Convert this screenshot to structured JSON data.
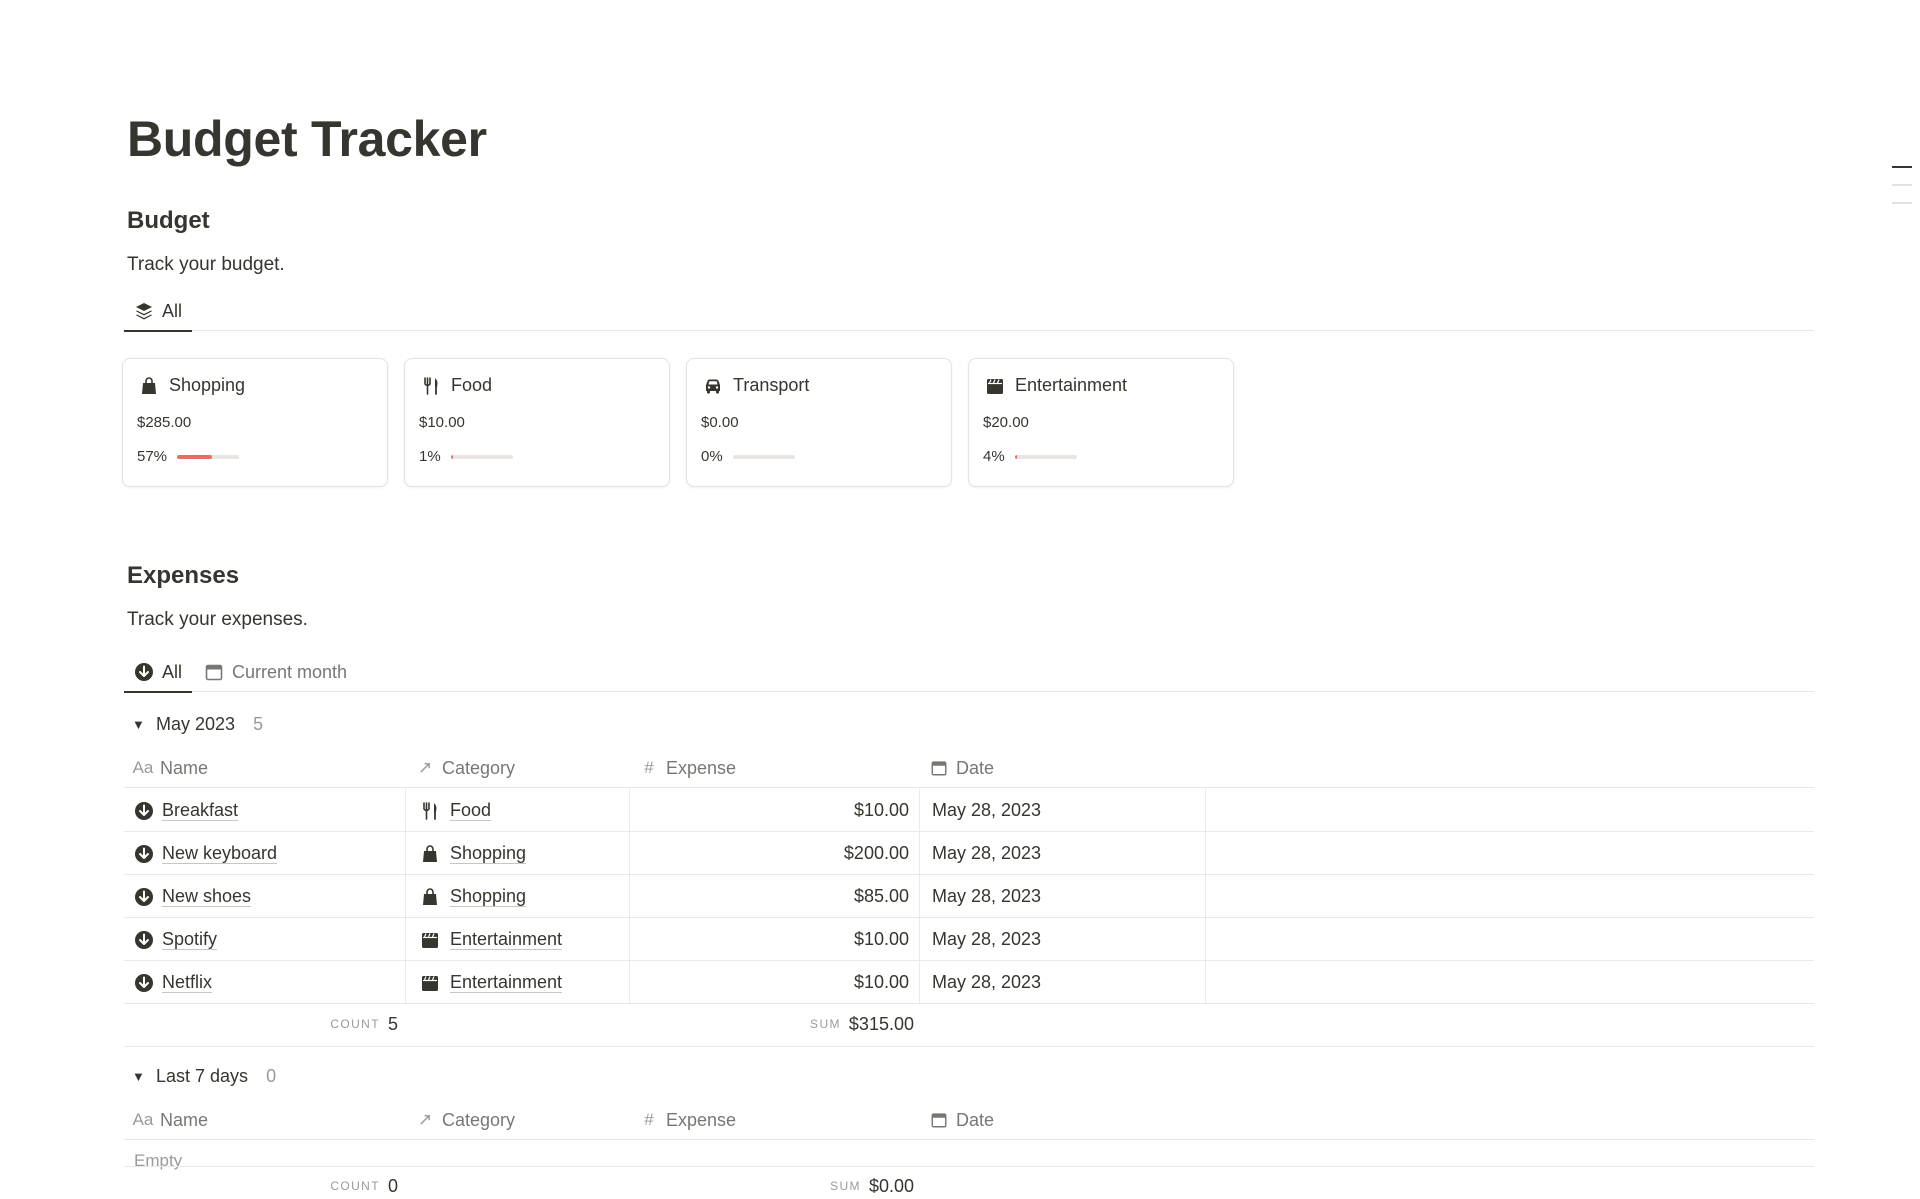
{
  "page": {
    "title": "Budget Tracker"
  },
  "toc": {
    "items": [
      "",
      "",
      ""
    ]
  },
  "budget": {
    "title": "Budget",
    "description": "Track your budget.",
    "tabs": [
      {
        "label": "All",
        "icon": "stack-icon"
      }
    ],
    "cards": [
      {
        "name": "Shopping",
        "icon": "shopping-bag-icon",
        "amount": "$285.00",
        "percent_label": "57%",
        "progress": 0.57
      },
      {
        "name": "Food",
        "icon": "fork-knife-icon",
        "amount": "$10.00",
        "percent_label": "1%",
        "progress": 0.01
      },
      {
        "name": "Transport",
        "icon": "car-icon",
        "amount": "$0.00",
        "percent_label": "0%",
        "progress": 0.0
      },
      {
        "name": "Entertainment",
        "icon": "clapperboard-icon",
        "amount": "$20.00",
        "percent_label": "4%",
        "progress": 0.04
      }
    ],
    "progress_color": "#e16f64"
  },
  "expenses": {
    "title": "Expenses",
    "description": "Track your expenses.",
    "tabs": [
      {
        "label": "All",
        "icon": "arrow-down-circle-icon"
      },
      {
        "label": "Current month",
        "icon": "calendar-icon"
      }
    ],
    "columns": {
      "name": {
        "label": "Name",
        "icon_text": "Aa"
      },
      "category": {
        "label": "Category",
        "icon_text": "↗"
      },
      "expense": {
        "label": "Expense",
        "icon_text": "#"
      },
      "date": {
        "label": "Date",
        "icon": "calendar-icon"
      }
    },
    "groups": [
      {
        "label": "May 2023",
        "count": "5",
        "rows": [
          {
            "name": "Breakfast",
            "category": "Food",
            "category_icon": "fork-knife-icon",
            "expense": "$10.00",
            "date": "May 28, 2023"
          },
          {
            "name": "New keyboard",
            "category": "Shopping",
            "category_icon": "shopping-bag-icon",
            "expense": "$200.00",
            "date": "May 28, 2023"
          },
          {
            "name": "New shoes",
            "category": "Shopping",
            "category_icon": "shopping-bag-icon",
            "expense": "$85.00",
            "date": "May 28, 2023"
          },
          {
            "name": "Spotify",
            "category": "Entertainment",
            "category_icon": "clapperboard-icon",
            "expense": "$10.00",
            "date": "May 28, 2023"
          },
          {
            "name": "Netflix",
            "category": "Entertainment",
            "category_icon": "clapperboard-icon",
            "expense": "$10.00",
            "date": "May 28, 2023"
          }
        ],
        "footer": {
          "count_label": "COUNT",
          "count_value": "5",
          "sum_label": "SUM",
          "sum_value": "$315.00"
        }
      },
      {
        "label": "Last 7 days",
        "count": "0",
        "rows": [],
        "empty_text": "Empty",
        "footer": {
          "count_label": "COUNT",
          "count_value": "0",
          "sum_label": "SUM",
          "sum_value": "$0.00"
        }
      }
    ]
  }
}
